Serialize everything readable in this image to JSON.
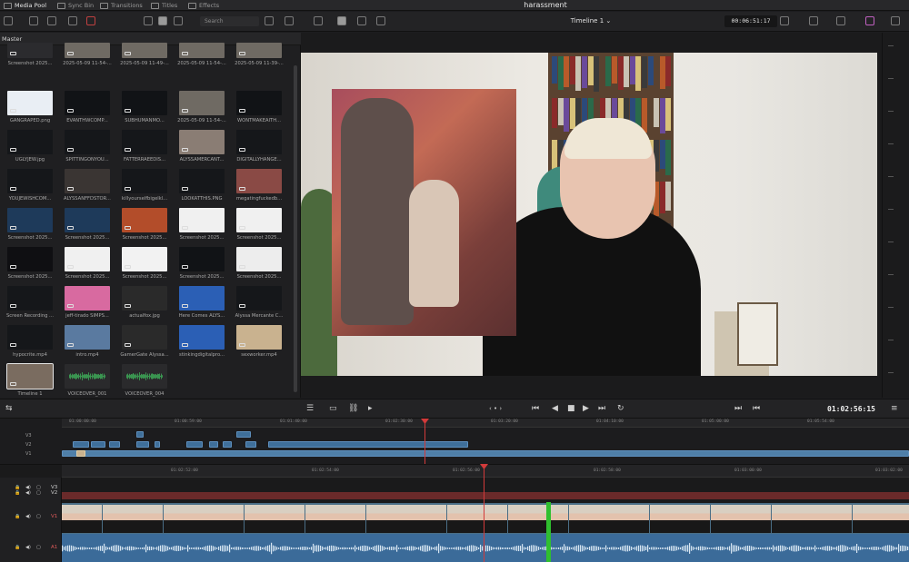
{
  "project_title": "harassment",
  "tabs": [
    {
      "label": "Media Pool",
      "active": true
    },
    {
      "label": "Sync Bin",
      "active": false
    },
    {
      "label": "Transitions",
      "active": false
    },
    {
      "label": "Titles",
      "active": false
    },
    {
      "label": "Effects",
      "active": false
    }
  ],
  "toolbar": {
    "search_placeholder": "Search",
    "timeline_name": "Timeline 1",
    "timecode": "00:06:51:17"
  },
  "media_pool": {
    "bin_name": "Master",
    "clips": [
      {
        "name": "Screenshot 2025...",
        "row": 0,
        "col": 0,
        "color": "#2b2b2e"
      },
      {
        "name": "2025-05-09 11-54-...",
        "row": 0,
        "col": 1,
        "color": "#6f6a63"
      },
      {
        "name": "2025-05-09 11-49-...",
        "row": 0,
        "col": 2,
        "color": "#6f6a63"
      },
      {
        "name": "2025-05-09 11-54-...",
        "row": 0,
        "col": 3,
        "color": "#6f6a63"
      },
      {
        "name": "2025-05-09 11-39-...",
        "row": 0,
        "col": 4,
        "color": "#6f6a63"
      },
      {
        "name": "GANGRAPED.png",
        "row": 1,
        "col": 0,
        "color": "#e9eef4"
      },
      {
        "name": "EVANTHWCOMP...",
        "row": 1,
        "col": 1,
        "color": "#111316"
      },
      {
        "name": "SUBHUMANMO...",
        "row": 1,
        "col": 2,
        "color": "#111316"
      },
      {
        "name": "2025-05-09 11-54-...",
        "row": 1,
        "col": 3,
        "color": "#6f6a63"
      },
      {
        "name": "WONTMAKEAITH...",
        "row": 1,
        "col": 4,
        "color": "#111316"
      },
      {
        "name": "UGLYJEW.jpg",
        "row": 2,
        "col": 0,
        "color": "#15171a"
      },
      {
        "name": "SPITTINGONYOU...",
        "row": 2,
        "col": 1,
        "color": "#15171a"
      },
      {
        "name": "FATTERRAEEDIS...",
        "row": 2,
        "col": 2,
        "color": "#15171a"
      },
      {
        "name": "ALYSSAMERCANT...",
        "row": 2,
        "col": 3,
        "color": "#8a7d74"
      },
      {
        "name": "DIGITALLYHANGE...",
        "row": 2,
        "col": 4,
        "color": "#15171a"
      },
      {
        "name": "YOUJEWISHCOM...",
        "row": 3,
        "col": 0,
        "color": "#15171a"
      },
      {
        "name": "ALYSSANFFDSTOR...",
        "row": 3,
        "col": 1,
        "color": "#3a3533"
      },
      {
        "name": "killyourselfbigelkl...",
        "row": 3,
        "col": 2,
        "color": "#15171a"
      },
      {
        "name": "LOOKATTHIS.PNG",
        "row": 3,
        "col": 3,
        "color": "#15171a"
      },
      {
        "name": "megatingfuckedb...",
        "row": 3,
        "col": 4,
        "color": "#8a4a45"
      },
      {
        "name": "Screenshot 2025...",
        "row": 4,
        "col": 0,
        "color": "#1e3a5a"
      },
      {
        "name": "Screenshot 2025...",
        "row": 4,
        "col": 1,
        "color": "#1e3a5a"
      },
      {
        "name": "Screenshot 2025...",
        "row": 4,
        "col": 2,
        "color": "#b34d2a"
      },
      {
        "name": "Screenshot 2025...",
        "row": 4,
        "col": 3,
        "color": "#f0f0f0"
      },
      {
        "name": "Screenshot 2025...",
        "row": 4,
        "col": 4,
        "color": "#f0f0f0"
      },
      {
        "name": "Screenshot 2025...",
        "row": 5,
        "col": 0,
        "color": "#0f0f12"
      },
      {
        "name": "Screenshot 2025...",
        "row": 5,
        "col": 1,
        "color": "#f0f0f0"
      },
      {
        "name": "Screenshot 2025...",
        "row": 5,
        "col": 2,
        "color": "#f2f2f2"
      },
      {
        "name": "Screenshot 2025...",
        "row": 5,
        "col": 3,
        "color": "#111316"
      },
      {
        "name": "Screenshot 2025...",
        "row": 5,
        "col": 4,
        "color": "#ededed"
      },
      {
        "name": "Screen Recording ...",
        "row": 6,
        "col": 0,
        "color": "#15171a"
      },
      {
        "name": "jeff-tirado SIMPS...",
        "row": 6,
        "col": 1,
        "color": "#d86aa0"
      },
      {
        "name": "actualfox.jpg",
        "row": 6,
        "col": 2,
        "color": "#2a2a2a"
      },
      {
        "name": "Here Comes ALYS...",
        "row": 6,
        "col": 3,
        "color": "#2b5fb5"
      },
      {
        "name": "Alyssa Mercante C...",
        "row": 6,
        "col": 4,
        "color": "#15171a"
      },
      {
        "name": "hypocrite.mp4",
        "row": 7,
        "col": 0,
        "color": "#15171a"
      },
      {
        "name": "intro.mp4",
        "row": 7,
        "col": 1,
        "color": "#5a7aa0"
      },
      {
        "name": "GamerGate Alyssa...",
        "row": 7,
        "col": 2,
        "color": "#2a2a2a"
      },
      {
        "name": "stinkingdigitalpro...",
        "row": 7,
        "col": 3,
        "color": "#2b5fb5"
      },
      {
        "name": "sexworker.mp4",
        "row": 7,
        "col": 4,
        "color": "#c9b28f"
      },
      {
        "name": "Timeline 1",
        "row": 8,
        "col": 0,
        "color": "#7a6c60"
      },
      {
        "name": "VOICEOVER_001",
        "row": 8,
        "col": 1,
        "color": "#2a2a2c",
        "audio": true
      },
      {
        "name": "VOICEOVER_004",
        "row": 8,
        "col": 2,
        "color": "#2a2a2c",
        "audio": true
      }
    ]
  },
  "transport": {
    "timecode": "01:02:56:15"
  },
  "mini_timeline": {
    "ruler_labels": [
      "01:00:00:00",
      "01:00:59:00",
      "01:01:40:00",
      "01:02:30:00",
      "01:03:20:00",
      "01:04:10:00",
      "01:05:00:00",
      "01:05:54:00",
      "01:06:40:00"
    ],
    "tracks": [
      "V3",
      "V2",
      "V1"
    ]
  },
  "main_timeline": {
    "ruler_labels": [
      "01:02:52:00",
      "01:02:54:00",
      "01:02:56:00",
      "01:02:58:00",
      "01:03:00:00",
      "01:03:02:00"
    ],
    "tracks": [
      {
        "id": "V3",
        "label": "V3"
      },
      {
        "id": "V2",
        "label": "V2"
      },
      {
        "id": "V1",
        "label": "V1"
      },
      {
        "id": "A1",
        "label": "A1"
      }
    ]
  },
  "colors": {
    "accent": "#d23a3a",
    "clip_blue": "#3f6f9a",
    "cut_green": "#2fbf2f"
  }
}
